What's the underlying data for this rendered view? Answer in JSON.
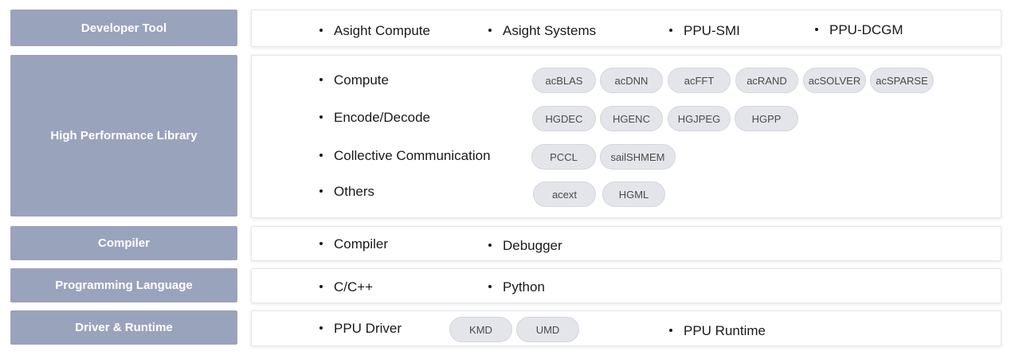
{
  "rows": {
    "developer_tool": {
      "label": "Developer Tool",
      "items": [
        "Asight Compute",
        "Asight Systems",
        "PPU-SMI",
        "PPU-DCGM"
      ]
    },
    "hpl": {
      "label": "High Performance Library",
      "groups": [
        {
          "name": "Compute",
          "pills": [
            "acBLAS",
            "acDNN",
            "acFFT",
            "acRAND",
            "acSOLVER",
            "acSPARSE"
          ]
        },
        {
          "name": "Encode/Decode",
          "pills": [
            "HGDEC",
            "HGENC",
            "HGJPEG",
            "HGPP"
          ]
        },
        {
          "name": "Collective Communication",
          "pills": [
            "PCCL",
            "sailSHMEM"
          ]
        },
        {
          "name": "Others",
          "pills": [
            "acext",
            "HGML"
          ]
        }
      ]
    },
    "compiler": {
      "label": "Compiler",
      "items": [
        "Compiler",
        "Debugger"
      ]
    },
    "programming_language": {
      "label": "Programming Language",
      "items": [
        "C/C++",
        "Python"
      ]
    },
    "driver_runtime": {
      "label": "Driver & Runtime",
      "items": [
        "PPU Driver",
        "PPU Runtime"
      ],
      "pills": [
        "KMD",
        "UMD"
      ]
    }
  }
}
